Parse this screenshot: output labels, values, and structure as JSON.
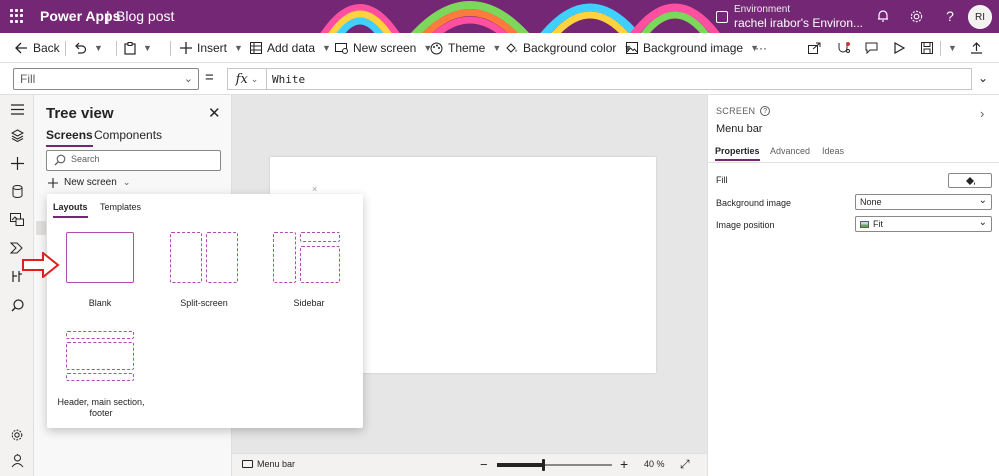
{
  "app": {
    "name": "Power Apps",
    "separator": "|",
    "document": "Blog post"
  },
  "environment": {
    "label": "Environment",
    "name": "rachel irabor's Environ..."
  },
  "user": {
    "initials": "RI"
  },
  "commandbar": {
    "back": "Back",
    "insert": "Insert",
    "add_data": "Add data",
    "new_screen": "New screen",
    "theme": "Theme",
    "background_color": "Background color",
    "background_image": "Background image",
    "more": "···"
  },
  "formula": {
    "property": "Fill",
    "equals": "=",
    "fx": "fx",
    "value": "White"
  },
  "tree": {
    "title": "Tree view",
    "tabs": [
      {
        "label": "Screens",
        "active": true
      },
      {
        "label": "Components",
        "active": false
      }
    ],
    "search_placeholder": "Search",
    "new_screen": "New screen"
  },
  "popover": {
    "tabs": [
      {
        "label": "Layouts",
        "active": true
      },
      {
        "label": "Templates",
        "active": false
      }
    ],
    "layouts": [
      {
        "label": "Blank",
        "selected": true
      },
      {
        "label": "Split-screen",
        "selected": false
      },
      {
        "label": "Sidebar",
        "selected": false
      },
      {
        "label": "Header, main section, footer",
        "selected": false
      }
    ]
  },
  "statusbar": {
    "screen_name": "Menu bar",
    "zoom_minus": "−",
    "zoom_plus": "+",
    "zoom_percent": 40,
    "zoom_label": "40  %"
  },
  "properties": {
    "kind": "SCREEN",
    "control_name": "Menu bar",
    "tabs": [
      {
        "label": "Properties",
        "active": true
      },
      {
        "label": "Advanced",
        "active": false
      },
      {
        "label": "Ideas",
        "active": false
      }
    ],
    "fill_label": "Fill",
    "background_image_label": "Background image",
    "background_image_value": "None",
    "image_position_label": "Image position",
    "image_position_value": "Fit"
  },
  "colors": {
    "titlebar": "#742774",
    "accent": "#742774",
    "annotation_arrow": "#e02020"
  }
}
